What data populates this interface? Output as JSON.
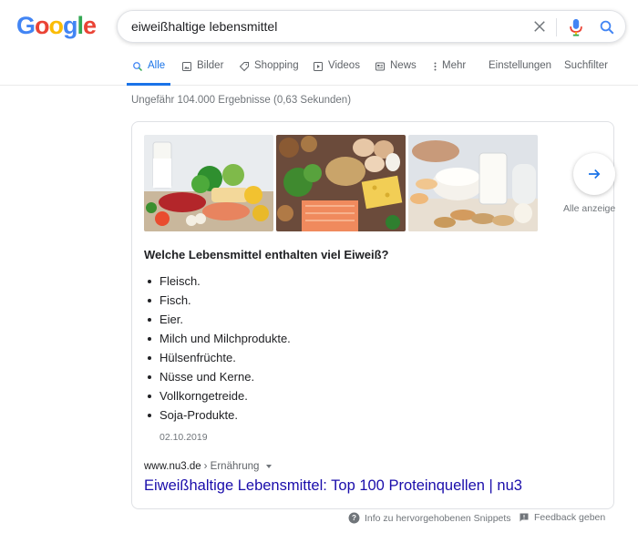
{
  "logo": [
    "G",
    "o",
    "o",
    "g",
    "l",
    "e"
  ],
  "colors": {
    "google_blue": "#4285F4",
    "google_red": "#EA4335",
    "google_yellow": "#FBBC05",
    "google_green": "#34A853",
    "link": "#1a0dab",
    "accent": "#1a73e8"
  },
  "search": {
    "query": "eiweißhaltige lebensmittel"
  },
  "tabs": [
    {
      "label": "Alle",
      "icon": "search-icon"
    },
    {
      "label": "Bilder",
      "icon": "image-icon"
    },
    {
      "label": "Shopping",
      "icon": "tag-icon"
    },
    {
      "label": "Videos",
      "icon": "play-icon"
    },
    {
      "label": "News",
      "icon": "news-icon"
    },
    {
      "label": "Mehr",
      "icon": "more-vert-icon"
    },
    {
      "label": "Einstellungen"
    },
    {
      "label": "Suchfilter"
    }
  ],
  "result_stats": "Ungefähr 104.000 Ergebnisse (0,63 Sekunden)",
  "featured_snippet": {
    "show_all_label": "Alle anzeigen",
    "question": "Welche Lebensmittel enthalten viel Eiweiß?",
    "items": [
      "Fleisch.",
      "Fisch.",
      "Eier.",
      "Milch und Milchprodukte.",
      "Hülsenfrüchte.",
      "Nüsse und Kerne.",
      "Vollkorngetreide.",
      "Soja-Produkte."
    ],
    "date": "02.10.2019",
    "source_domain": "www.nu3.de",
    "source_breadcrumb": "› Ernährung",
    "link_title": "Eiweißhaltige Lebensmittel: Top 100 Proteinquellen | nu3"
  },
  "footer": {
    "info_label": "Info zu hervorgehobenen Snippets",
    "feedback_label": "Feedback geben"
  }
}
